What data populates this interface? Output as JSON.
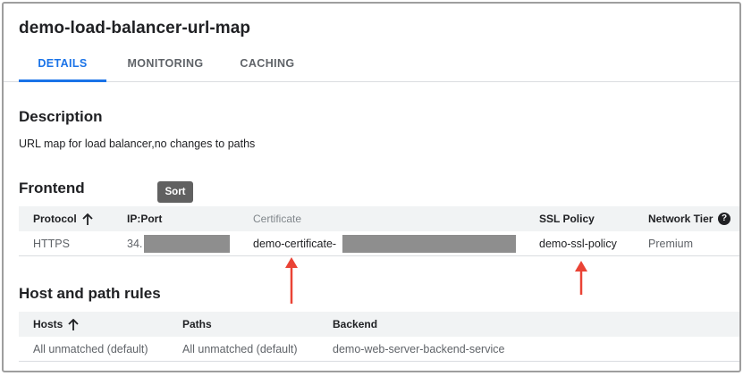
{
  "page": {
    "title": "demo-load-balancer-url-map"
  },
  "tabs": [
    {
      "label": "DETAILS",
      "active": true
    },
    {
      "label": "MONITORING",
      "active": false
    },
    {
      "label": "CACHING",
      "active": false
    }
  ],
  "description": {
    "heading": "Description",
    "text": "URL map for load balancer,no changes to paths"
  },
  "frontend": {
    "heading": "Frontend",
    "sort_tooltip": "Sort",
    "columns": {
      "protocol": "Protocol",
      "ip_port": "IP:Port",
      "certificate": "Certificate",
      "ssl_policy": "SSL Policy",
      "network_tier": "Network Tier"
    },
    "row": {
      "protocol": "HTTPS",
      "ip_port": "34.",
      "certificate": "demo-certificate-",
      "ssl_policy": "demo-ssl-policy",
      "network_tier": "Premium"
    }
  },
  "host_path_rules": {
    "heading": "Host and path rules",
    "columns": {
      "hosts": "Hosts",
      "paths": "Paths",
      "backend": "Backend"
    },
    "row": {
      "hosts": "All unmatched (default)",
      "paths": "All unmatched (default)",
      "backend": "demo-web-server-backend-service"
    }
  },
  "icons": {
    "sort": "arrow-upward-icon",
    "help": "help-circle-icon",
    "annotation": "red-arrow-annotation"
  },
  "colors": {
    "accent": "#1a73e8",
    "annotation": "#ea4335",
    "redaction": "#8e8e8e",
    "tooltip": "#616161"
  }
}
